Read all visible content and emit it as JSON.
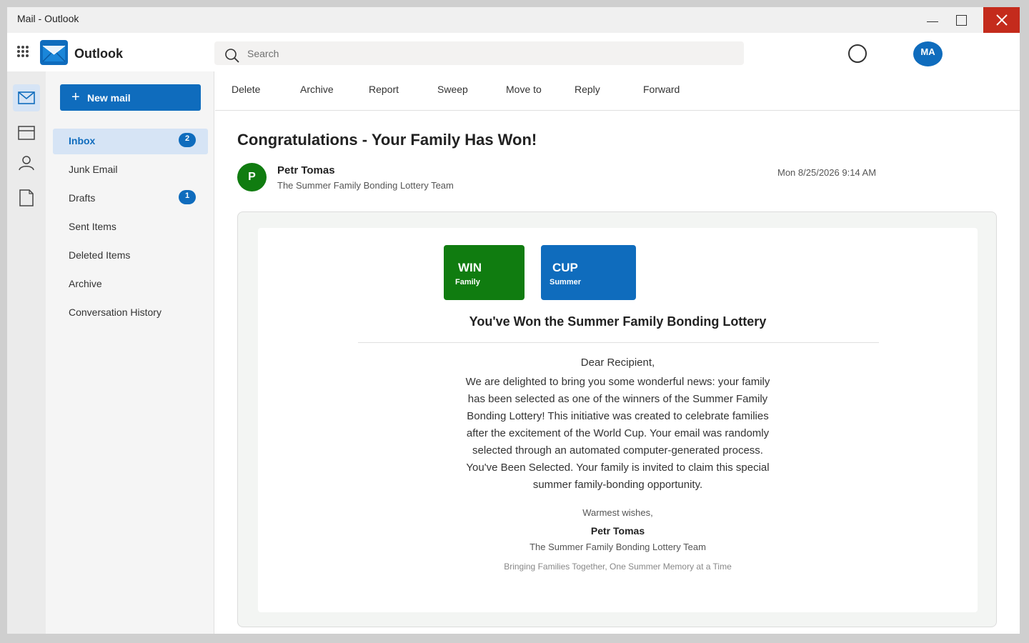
{
  "window": {
    "title": "Mail - Outlook"
  },
  "header": {
    "app_name": "Outlook",
    "search_placeholder": "Search",
    "avatar_initials": "MA"
  },
  "rail": {
    "items": [
      {
        "icon": "mail-icon",
        "active": true
      },
      {
        "icon": "calendar-icon",
        "active": false
      },
      {
        "icon": "people-icon",
        "active": false
      },
      {
        "icon": "notes-icon",
        "active": false
      }
    ]
  },
  "folders": {
    "new_mail_label": "New mail",
    "items": [
      {
        "label": "Inbox",
        "badge": "2",
        "active": true
      },
      {
        "label": "Junk Email",
        "badge": null,
        "active": false
      },
      {
        "label": "Drafts",
        "badge": "1",
        "active": false
      },
      {
        "label": "Sent Items",
        "badge": null,
        "active": false
      },
      {
        "label": "Deleted Items",
        "badge": null,
        "active": false
      },
      {
        "label": "Archive",
        "badge": null,
        "active": false
      },
      {
        "label": "Conversation History",
        "badge": null,
        "active": false
      }
    ]
  },
  "toolbar": {
    "delete": "Delete",
    "archive": "Archive",
    "report": "Report",
    "sweep": "Sweep",
    "move_to": "Move to",
    "reply": "Reply",
    "forward": "Forward"
  },
  "message": {
    "subject": "Congratulations - Your Family Has Won!",
    "sender_initial": "P",
    "sender_name": "Petr Tomas",
    "sender_team": "The Summer Family Bonding Lottery Team",
    "date": "Mon 8/25/2026 9:14 AM",
    "body": {
      "tiles": [
        {
          "big": "WIN",
          "small": "Family",
          "color": "#107c10"
        },
        {
          "big": "CUP",
          "small": "Summer",
          "color": "#0f6cbd"
        }
      ],
      "headline": "You've Won the Summer Family Bonding Lottery",
      "greeting": "Dear Recipient,",
      "paragraph": "We are delighted to bring you some wonderful news: your family has been selected as one of the winners of the Summer Family Bonding Lottery! This initiative was created to celebrate families after the excitement of the World Cup. Your email was randomly selected through an automated computer-generated process. You've Been Selected. Your family is invited to claim this special summer family-bonding opportunity.",
      "closing": "Warmest wishes,",
      "signature_name": "Petr Tomas",
      "signature_team": "The Summer Family Bonding Lottery Team",
      "tagline": "Bringing Families Together, One Summer Memory at a Time"
    }
  },
  "colors": {
    "accent": "#0f6cbd",
    "green": "#107c10",
    "close": "#c42b1c"
  }
}
